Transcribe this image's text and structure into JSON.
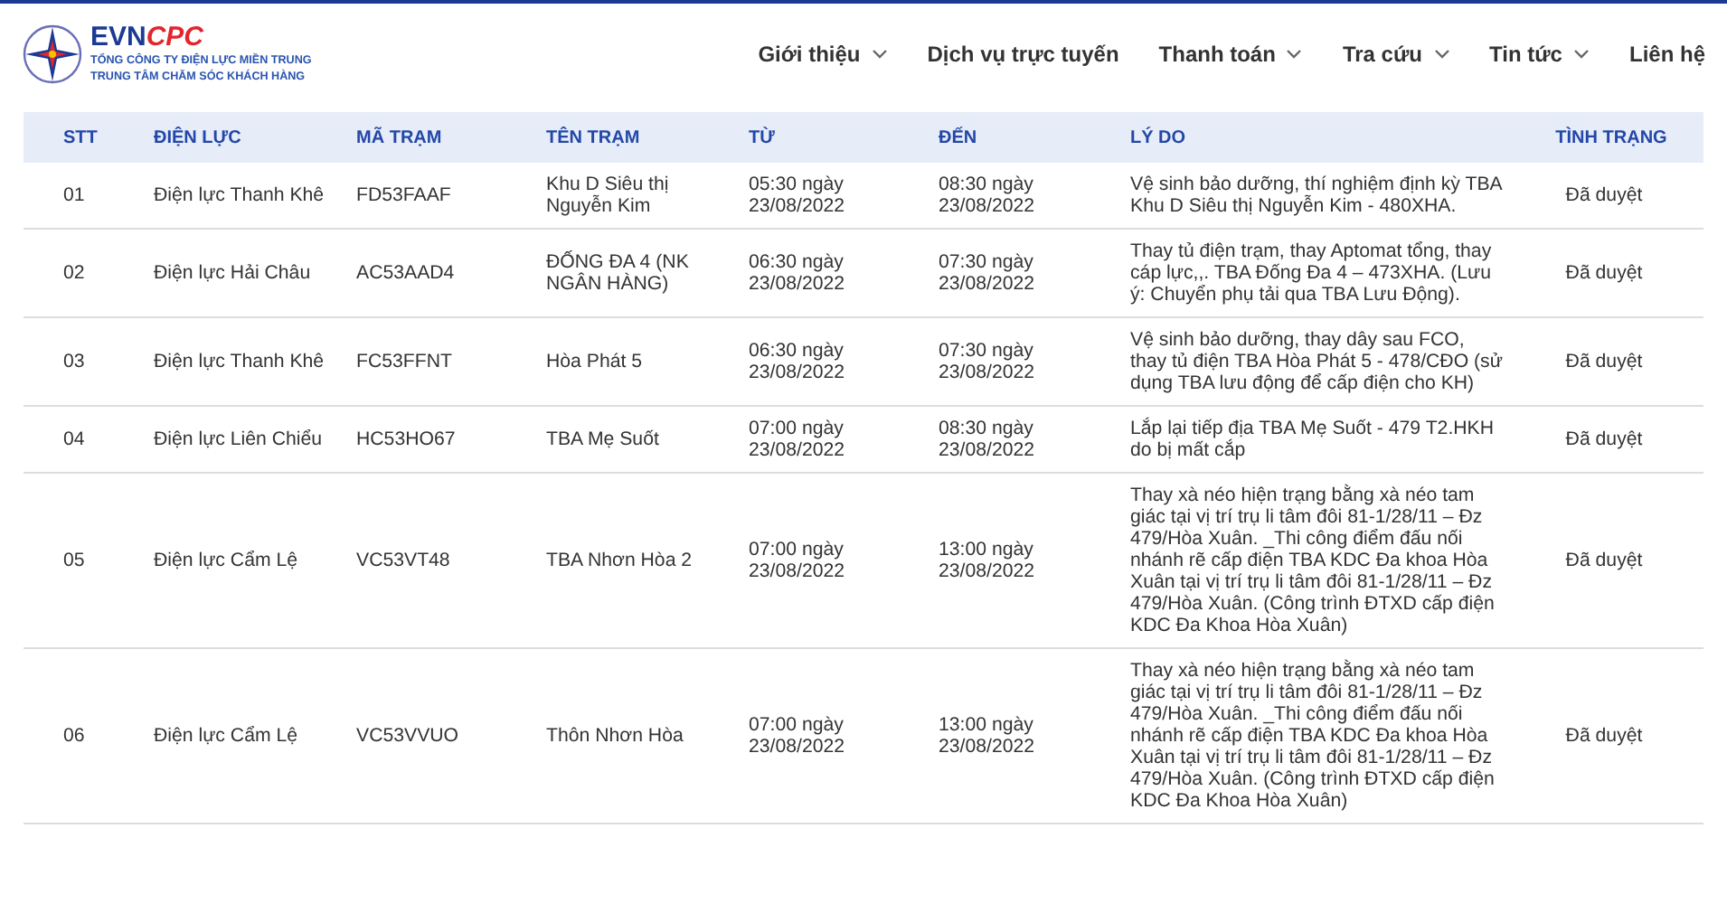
{
  "logo": {
    "brand_primary": "EVN",
    "brand_secondary": "CPC",
    "subtitle_lines": [
      "TỔNG CÔNG TY ĐIỆN LỰC MIỀN TRUNG",
      "TRUNG TÂM CHĂM SÓC KHÁCH HÀNG"
    ]
  },
  "nav": [
    {
      "label": "Giới thiệu",
      "has_menu": true
    },
    {
      "label": "Dịch vụ trực tuyến",
      "has_menu": false
    },
    {
      "label": "Thanh toán",
      "has_menu": true
    },
    {
      "label": "Tra cứu",
      "has_menu": true
    },
    {
      "label": "Tin tức",
      "has_menu": true
    },
    {
      "label": "Liên hệ",
      "has_menu": false
    }
  ],
  "table": {
    "columns": [
      "STT",
      "ĐIỆN LỰC",
      "MÃ TRẠM",
      "TÊN TRẠM",
      "TỪ",
      "ĐẾN",
      "LÝ DO",
      "TÌNH TRẠNG"
    ],
    "rows": [
      [
        "01",
        "Điện lực Thanh Khê",
        "FD53FAAF",
        "Khu D Siêu thị Nguyễn Kim",
        "05:30 ngày 23/08/2022",
        "08:30 ngày 23/08/2022",
        "Vệ sinh bảo dưỡng, thí nghiệm định kỳ TBA Khu D Siêu thị Nguyễn Kim - 480XHA.",
        "Đã duyệt"
      ],
      [
        "02",
        "Điện lực Hải Châu",
        "AC53AAD4",
        "ĐỐNG ĐA 4 (NK NGÂN HÀNG)",
        "06:30 ngày 23/08/2022",
        "07:30 ngày 23/08/2022",
        "Thay tủ điện trạm, thay Aptomat tổng, thay cáp lực,,. TBA Đống Đa 4 – 473XHA. (Lưu ý: Chuyển phụ tải qua TBA Lưu Động).",
        "Đã duyệt"
      ],
      [
        "03",
        "Điện lực Thanh Khê",
        "FC53FFNT",
        "Hòa Phát 5",
        "06:30 ngày 23/08/2022",
        "07:30 ngày 23/08/2022",
        "Vệ sinh bảo dưỡng, thay dây sau FCO, thay tủ điện TBA Hòa Phát 5 - 478/CĐO (sử dụng TBA lưu động để cấp điện cho KH)",
        "Đã duyệt"
      ],
      [
        "04",
        "Điện lực Liên Chiểu",
        "HC53HO67",
        "TBA Mẹ Suốt",
        "07:00 ngày 23/08/2022",
        "08:30 ngày 23/08/2022",
        "Lắp lại tiếp địa TBA Mẹ Suốt - 479 T2.HKH do bị mất cắp",
        "Đã duyệt"
      ],
      [
        "05",
        "Điện lực Cẩm Lệ",
        "VC53VT48",
        "TBA Nhơn Hòa 2",
        "07:00 ngày 23/08/2022",
        "13:00 ngày 23/08/2022",
        "Thay xà néo hiện trạng bằng xà néo tam giác tại vị trí trụ li tâm đôi 81-1/28/11 – Đz 479/Hòa Xuân. _Thi công điểm đấu nối nhánh rẽ cấp điện TBA KDC Đa khoa Hòa Xuân tại vị trí trụ li tâm đôi 81-1/28/11 – Đz 479/Hòa Xuân. (Công trình ĐTXD cấp điện KDC Đa Khoa Hòa Xuân)",
        "Đã duyệt"
      ],
      [
        "06",
        "Điện lực Cẩm Lệ",
        "VC53VVUO",
        "Thôn Nhơn Hòa",
        "07:00 ngày 23/08/2022",
        "13:00 ngày 23/08/2022",
        "Thay xà néo hiện trạng bằng xà néo tam giác tại vị trí trụ li tâm đôi 81-1/28/11 – Đz 479/Hòa Xuân. _Thi công điểm đấu nối nhánh rẽ cấp điện TBA KDC Đa khoa Hòa Xuân tại vị trí trụ li tâm đôi 81-1/28/11 – Đz 479/Hòa Xuân. (Công trình ĐTXD cấp điện KDC Đa Khoa Hòa Xuân)",
        "Đã duyệt"
      ]
    ]
  }
}
